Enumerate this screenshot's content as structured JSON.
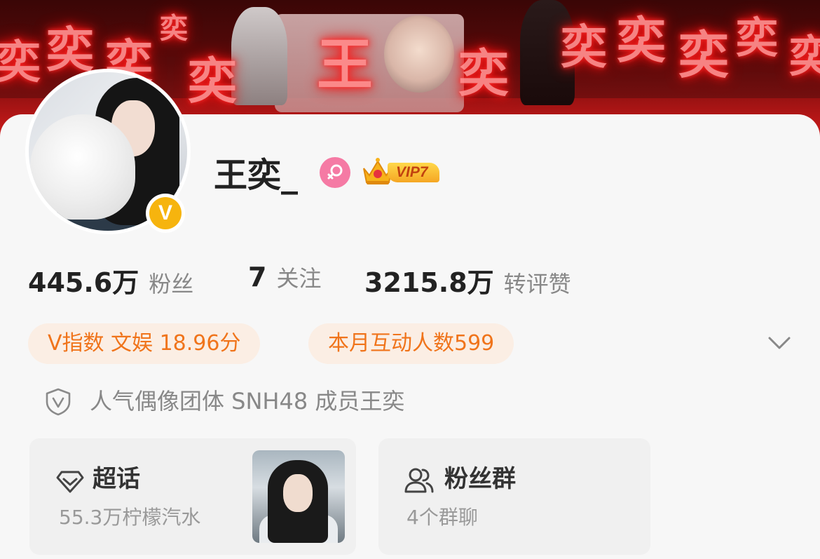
{
  "banner": {
    "glow_chars": [
      "奕",
      "奕",
      "奕",
      "奕",
      "奕",
      "王",
      "奕",
      "奕",
      "奕",
      "奕",
      "奕",
      "奕"
    ]
  },
  "profile": {
    "name": "王奕_",
    "gender_symbol": "♀",
    "vip_label": "VIP7",
    "verified_mark": "V"
  },
  "stats": {
    "followers_value": "445.6万",
    "followers_label": "粉丝",
    "following_value": "7",
    "following_label": "关注",
    "reposts_value": "3215.8万",
    "reposts_label": "转评赞"
  },
  "tags": {
    "v_index": "V指数 文娱 18.96分",
    "monthly_interactions": "本月互动人数599"
  },
  "verification": {
    "text": "人气偶像团体 SNH48 成员王奕"
  },
  "supertopic": {
    "title": "超话",
    "subtitle": "55.3万柠檬汽水"
  },
  "fan_group": {
    "title": "粉丝群",
    "subtitle": "4个群聊"
  },
  "colors": {
    "accent_orange": "#f0741b",
    "tag_background": "#fbeee4",
    "verified_gold": "#f6b40e",
    "gender_pink": "#f57aa4",
    "banner_red": "#d21c1c"
  }
}
